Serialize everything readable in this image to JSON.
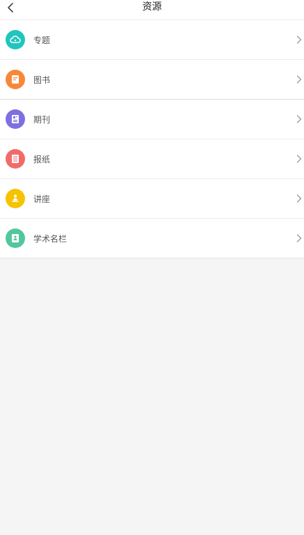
{
  "header": {
    "title": "资源",
    "back_icon": "chevron-left-icon"
  },
  "items": [
    {
      "label": "专题",
      "icon": "cloud-icon",
      "color": "#22c5bd"
    },
    {
      "label": "图书",
      "icon": "book-icon",
      "color": "#f8873a"
    },
    {
      "label": "期刊",
      "icon": "journal-icon",
      "color": "#7e70e0"
    },
    {
      "label": "报纸",
      "icon": "newspaper-icon",
      "color": "#f26b6b"
    },
    {
      "label": "讲座",
      "icon": "lecture-icon",
      "color": "#f6c300"
    },
    {
      "label": "学术名栏",
      "icon": "academic-icon",
      "color": "#52c79b"
    }
  ],
  "chevron_icon": "chevron-right-icon"
}
